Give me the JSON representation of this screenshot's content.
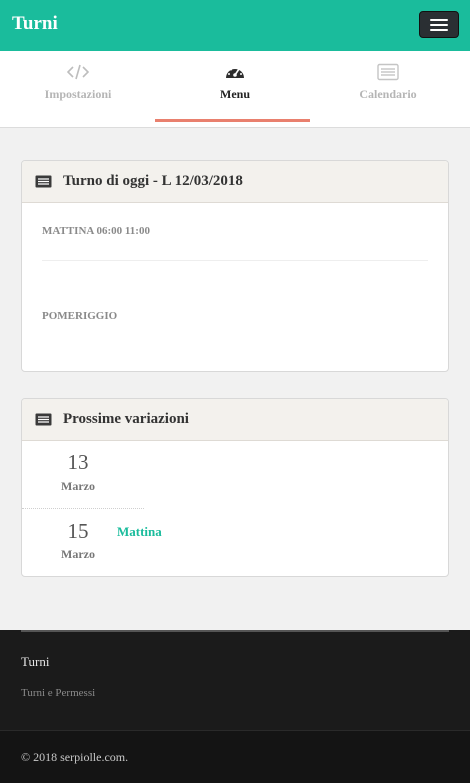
{
  "navbar": {
    "brand": "Turni",
    "menu_icon": "hamburger-icon"
  },
  "tabs": [
    {
      "label": "Impostazioni",
      "icon": "code-icon",
      "active": false
    },
    {
      "label": "Menu",
      "icon": "dashboard-icon",
      "active": true
    },
    {
      "label": "Calendario",
      "icon": "list-icon",
      "active": false
    }
  ],
  "today_panel": {
    "title": "Turno di oggi - L 12/03/2018",
    "icon": "list-icon",
    "shifts": [
      "MATTINA 06:00 11:00",
      "POMERIGGIO"
    ]
  },
  "variations_panel": {
    "title": "Prossime variazioni",
    "icon": "list-icon",
    "items": [
      {
        "day": "13",
        "month": "Marzo",
        "shift": ""
      },
      {
        "day": "15",
        "month": "Marzo",
        "shift": "Mattina"
      }
    ]
  },
  "footer": {
    "title": "Turni",
    "subtitle": "Turni e Permessi",
    "copyright": "© 2018 serpiolle.com."
  },
  "colors": {
    "accent": "#1abc9c",
    "tab_underline": "#e9806e",
    "footer_bg": "#1b1b1b"
  }
}
